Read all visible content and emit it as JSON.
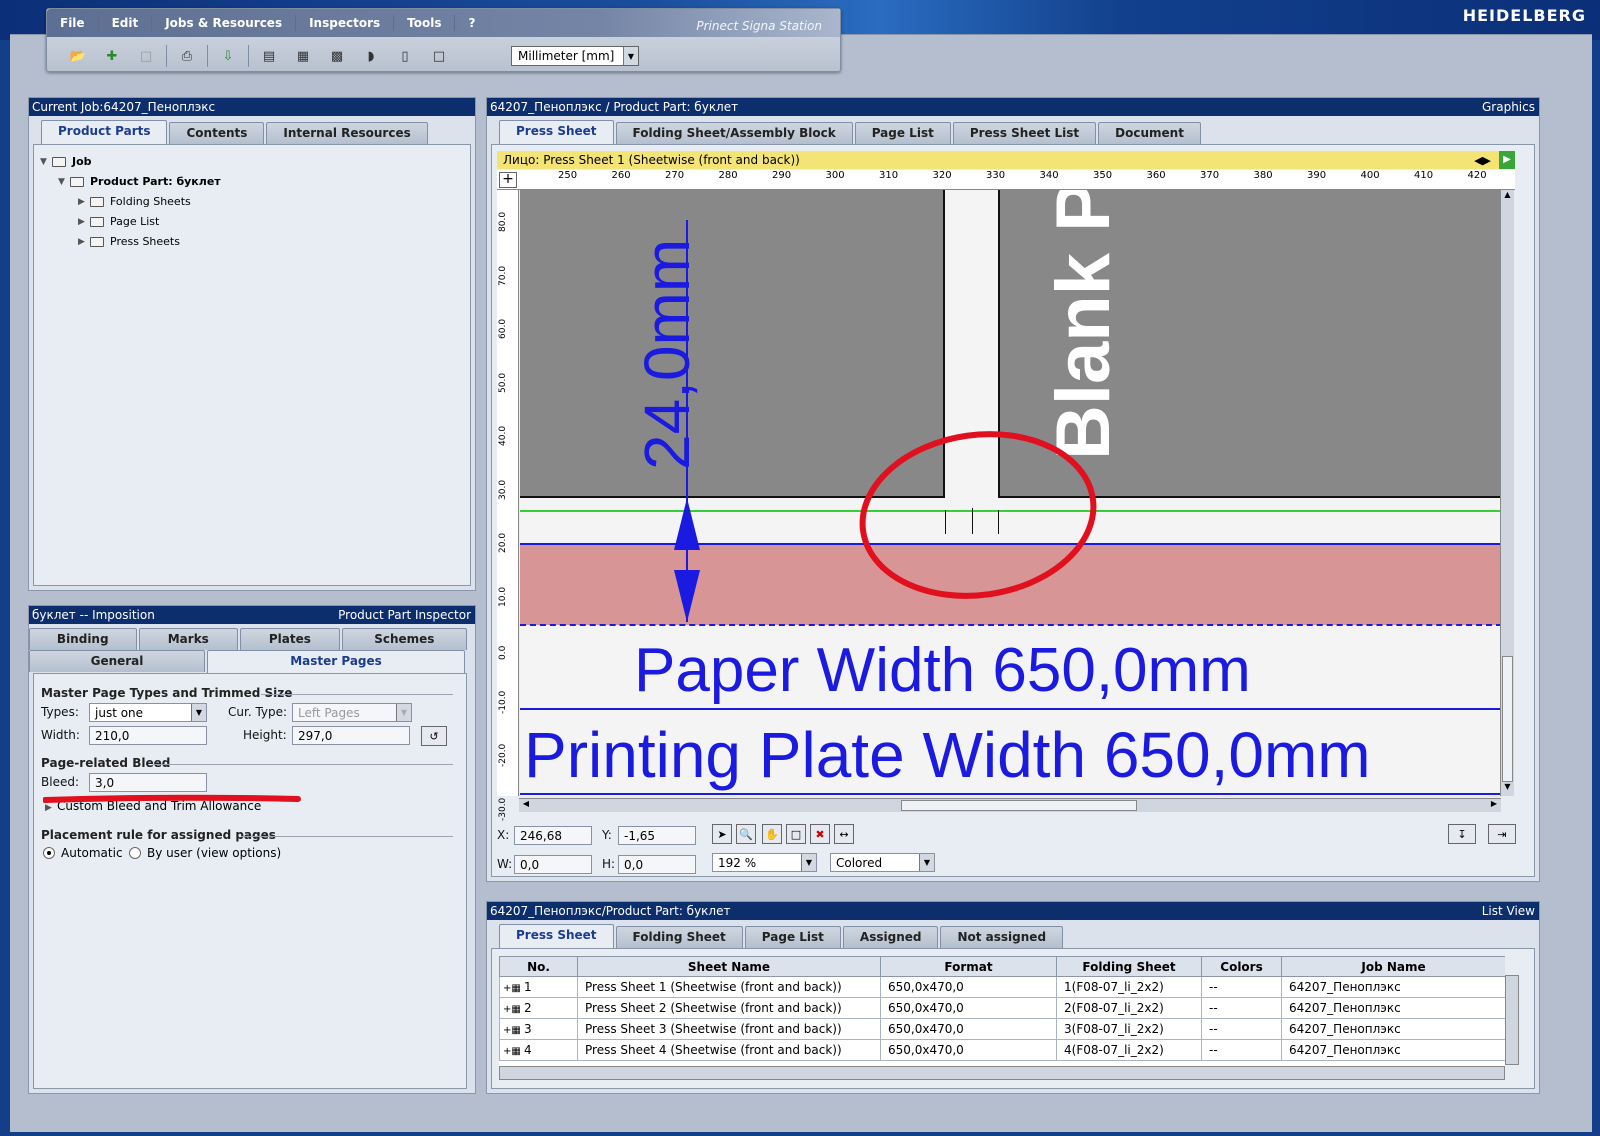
{
  "brand": "HEIDELBERG",
  "menu": {
    "file": "File",
    "edit": "Edit",
    "jobs": "Jobs & Resources",
    "inspectors": "Inspectors",
    "tools": "Tools",
    "help": "?",
    "app_name": "Prinect Signa Station"
  },
  "unit_select": "Millimeter  [mm]",
  "left_panel": {
    "title": "Current Job:64207_Пеноплэкс",
    "tabs": [
      "Product Parts",
      "Contents",
      "Internal Resources"
    ],
    "tree": {
      "job": "Job",
      "product_part": "Product Part: буклет",
      "folding_sheets": "Folding Sheets",
      "page_list": "Page List",
      "press_sheets": "Press Sheets"
    }
  },
  "inspector": {
    "title": "буклет -- Imposition",
    "title_right": "Product Part Inspector",
    "tabs_row1": [
      "Binding",
      "Marks",
      "Plates",
      "Schemes"
    ],
    "tabs_row2": [
      "General",
      "Master Pages"
    ],
    "group1": "Master Page Types and Trimmed Size",
    "types_label": "Types:",
    "types_value": "just one",
    "curtype_label": "Cur. Type:",
    "curtype_value": "Left Pages",
    "width_label": "Width:",
    "width_value": "210,0",
    "height_label": "Height:",
    "height_value": "297,0",
    "group2": "Page-related Bleed",
    "bleed_label": "Bleed:",
    "bleed_value": "3,0",
    "custom_bleed": "Custom Bleed and Trim Allowance",
    "group3": "Placement rule for assigned pages",
    "radio_auto": "Automatic",
    "radio_user": "By user (view options)"
  },
  "graphics": {
    "title": "64207_Пеноплэкс / Product Part: буклет",
    "title_right": "Graphics",
    "tabs": [
      "Press Sheet",
      "Folding Sheet/Assembly Block",
      "Page List",
      "Press Sheet List",
      "Document"
    ],
    "sheet_label": "Лицо:  Press Sheet 1 (Sheetwise (front and back))",
    "ruler_top": [
      "250",
      "260",
      "270",
      "280",
      "290",
      "300",
      "310",
      "320",
      "330",
      "340",
      "350",
      "360",
      "370",
      "380",
      "390",
      "400",
      "410",
      "420"
    ],
    "ruler_left": [
      "80.0",
      "70.0",
      "60.0",
      "50.0",
      "40.0",
      "30.0",
      "20.0",
      "10.0",
      "0.0",
      "-10.0",
      "-20.0",
      "-30.0"
    ],
    "annotation_dim": "24,0mm",
    "annotation_blank": "Blank P",
    "annotation_paper": "Paper Width 650,0mm",
    "annotation_plate": "Printing Plate Width 650,0mm",
    "x_label": "X:",
    "x_value": "246,68",
    "y_label": "Y:",
    "y_value": "-1,65",
    "w_label": "W:",
    "w_value": "0,0",
    "h_label": "H:",
    "h_value": "0,0",
    "zoom": "192 %",
    "color_mode": "Colored"
  },
  "listview": {
    "title": "64207_Пеноплэкс/Product Part: буклет",
    "title_right": "List View",
    "tabs": [
      "Press Sheet",
      "Folding Sheet",
      "Page List",
      "Assigned",
      "Not assigned"
    ],
    "columns": [
      "No.",
      "Sheet Name",
      "Format",
      "Folding Sheet",
      "Colors",
      "Job Name"
    ],
    "rows": [
      {
        "no": "1",
        "name": "Press Sheet 1 (Sheetwise (front and back))",
        "format": "650,0x470,0",
        "folding": "1(F08-07_li_2x2)",
        "colors": "--",
        "job": "64207_Пеноплэкс"
      },
      {
        "no": "2",
        "name": "Press Sheet 2 (Sheetwise (front and back))",
        "format": "650,0x470,0",
        "folding": "2(F08-07_li_2x2)",
        "colors": "--",
        "job": "64207_Пеноплэкс"
      },
      {
        "no": "3",
        "name": "Press Sheet 3 (Sheetwise (front and back))",
        "format": "650,0x470,0",
        "folding": "3(F08-07_li_2x2)",
        "colors": "--",
        "job": "64207_Пеноплэкс"
      },
      {
        "no": "4",
        "name": "Press Sheet 4 (Sheetwise (front and back))",
        "format": "650,0x470,0",
        "folding": "4(F08-07_li_2x2)",
        "colors": "--",
        "job": "64207_Пеноплэкс"
      }
    ]
  }
}
